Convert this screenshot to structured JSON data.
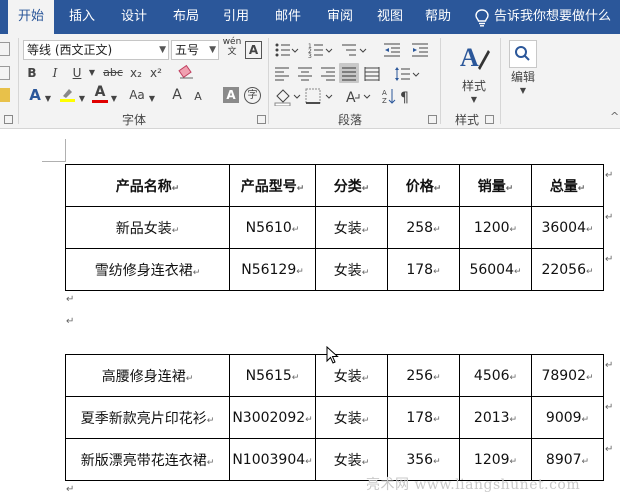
{
  "ribbon_tabs": [
    {
      "label": "开始",
      "active": true
    },
    {
      "label": "插入"
    },
    {
      "label": "设计"
    },
    {
      "label": "布局"
    },
    {
      "label": "引用"
    },
    {
      "label": "邮件"
    },
    {
      "label": "审阅"
    },
    {
      "label": "视图"
    },
    {
      "label": "帮助"
    }
  ],
  "tell_me": "告诉我你想要做什么",
  "font": {
    "name": "等线 (西文正文)",
    "size": "五号",
    "wen_glyph": "wén\n文",
    "A_glyph": "A"
  },
  "font_buttons": {
    "bold": "B",
    "italic": "I",
    "underline": "U",
    "strike": "abc",
    "subscript": "x₂",
    "superscript": "x²",
    "change_case": "Aa",
    "grow": "A",
    "shrink": "A",
    "shade": "A",
    "enclose": "字"
  },
  "groups": {
    "font": "字体",
    "paragraph": "段落",
    "styles": "样式",
    "editing": "编辑"
  },
  "styles_button": "样式",
  "editing_button": "编辑",
  "accent_colors": {
    "ribbon": "#2b579a",
    "highlight": "#ffff00",
    "font_color": "#e00000",
    "style_a": "#2b579a"
  },
  "table1": {
    "header": [
      "产品名称",
      "产品型号",
      "分类",
      "价格",
      "销量",
      "总量"
    ],
    "rows": [
      [
        "新品女装",
        "N5610",
        "女装",
        "258",
        "1200",
        "36004"
      ],
      [
        "雪纺修身连衣裙",
        "N56129",
        "女装",
        "178",
        "56004",
        "22056"
      ]
    ]
  },
  "table2": {
    "rows": [
      [
        "高腰修身连裙",
        "N5615",
        "女装",
        "256",
        "4506",
        "78902"
      ],
      [
        "夏季新款亮片印花衫",
        "N3002092",
        "女装",
        "178",
        "2013",
        "9009"
      ],
      [
        "新版漂亮带花连衣裙",
        "N1003904",
        "女装",
        "356",
        "1209",
        "8907"
      ]
    ]
  },
  "marks": {
    "cell": "↵",
    "para": "↵"
  },
  "watermark": "亮术网 www.liangshunet.com"
}
